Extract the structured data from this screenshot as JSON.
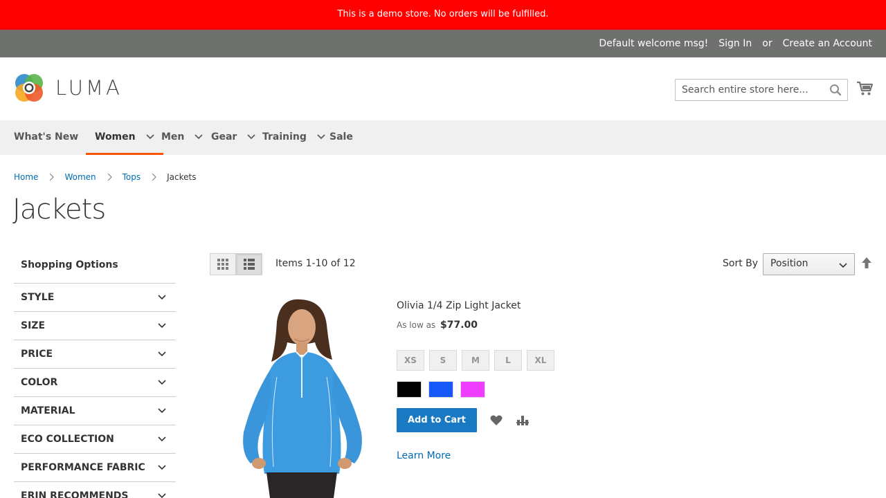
{
  "demo_notice": "This is a demo store. No orders will be fulfilled.",
  "panel": {
    "welcome": "Default welcome msg!",
    "sign_in": "Sign In",
    "or": "or",
    "create_account": "Create an Account"
  },
  "logo": {
    "text": "LUMA"
  },
  "search": {
    "placeholder": "Search entire store here..."
  },
  "nav": {
    "items": [
      {
        "label": "What's New",
        "has_children": false
      },
      {
        "label": "Women",
        "has_children": true,
        "active": true
      },
      {
        "label": "Men",
        "has_children": true
      },
      {
        "label": "Gear",
        "has_children": true
      },
      {
        "label": "Training",
        "has_children": true
      },
      {
        "label": "Sale",
        "has_children": false
      }
    ]
  },
  "breadcrumbs": [
    "Home",
    "Women",
    "Tops",
    "Jackets"
  ],
  "page_title": "Jackets",
  "sidebar": {
    "title": "Shopping Options",
    "filters": [
      "Style",
      "Size",
      "Price",
      "Color",
      "Material",
      "Eco Collection",
      "Performance Fabric",
      "Erin Recommends"
    ]
  },
  "toolbar": {
    "amount": "Items 1-10 of 12",
    "sort_label": "Sort By",
    "sort_value": "Position"
  },
  "product": {
    "name": "Olivia 1/4 Zip Light Jacket",
    "price_prefix": "As low as",
    "price": "$77.00",
    "sizes": [
      "XS",
      "S",
      "M",
      "L",
      "XL"
    ],
    "colors": [
      "#000000",
      "#1857f7",
      "#ef3dff"
    ],
    "add_to_cart": "Add to Cart",
    "learn_more": "Learn More"
  },
  "colors": {
    "demo_bar": "#ff0101",
    "panel": "#6e716e",
    "primary": "#1979c3",
    "link": "#006bb4",
    "nav_active": "#ff5501"
  }
}
